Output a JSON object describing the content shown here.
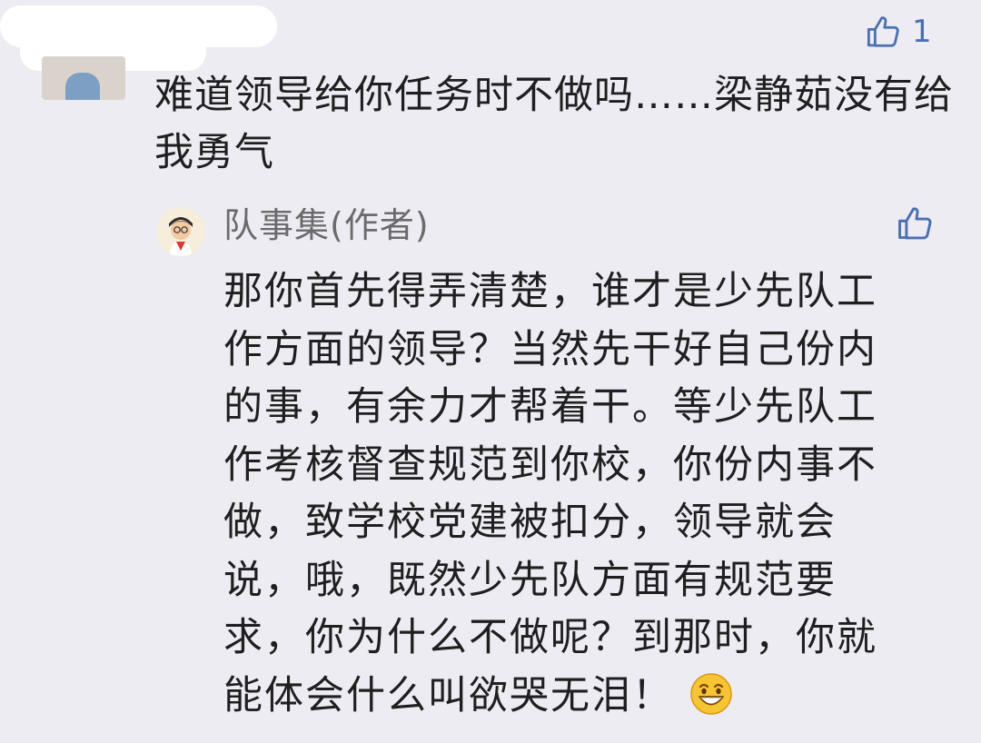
{
  "comment": {
    "likes": "1",
    "text": "难道领导给你任务时不做吗……梁静茹没有给我勇气"
  },
  "reply": {
    "author": "队事集(作者)",
    "text": "那你首先得弄清楚，谁才是少先队工作方面的领导？当然先干好自己份内的事，有余力才帮着干。等少先队工作考核督查规范到你校，你份内事不做，致学校党建被扣分，领导就会说，哦，既然少先队方面有规范要求，你为什么不做呢？到那时，你就能体会什么叫欲哭无泪！"
  },
  "icons": {
    "like": "thumbs-up-icon",
    "emoji": "grinning-face-emoji"
  },
  "colors": {
    "background": "#ececf2",
    "like_blue": "#4a6fb5",
    "author_gray": "#6b6b6b"
  }
}
